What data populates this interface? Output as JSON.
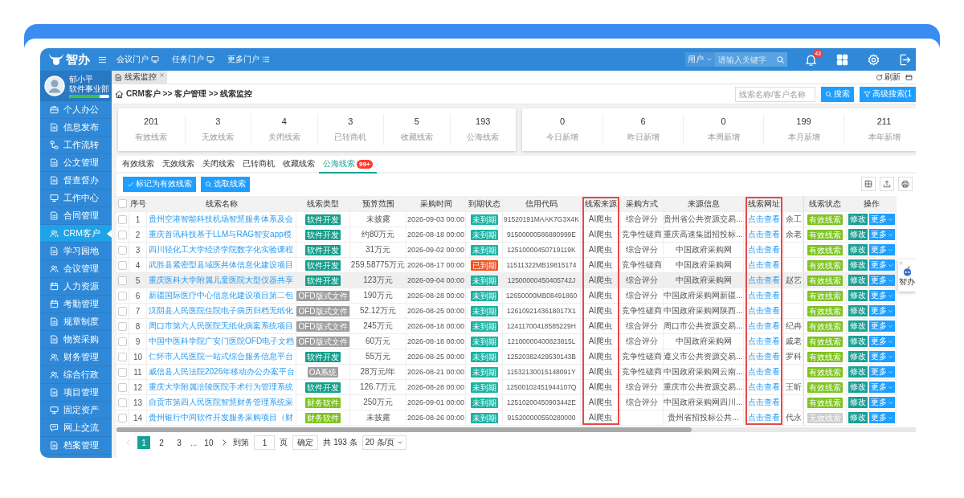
{
  "header": {
    "logo": "智办",
    "nav": [
      {
        "label": "会议门户",
        "kind": "screen"
      },
      {
        "label": "任务门户",
        "kind": "screen"
      },
      {
        "label": "更多门户",
        "kind": "list"
      }
    ],
    "search": {
      "scope": "用户",
      "placeholder": "请输入关键字"
    },
    "notifications": "43"
  },
  "user": {
    "name": "郁小平",
    "department": "软件事业部",
    "level": 0.75
  },
  "sidebar": {
    "items": [
      {
        "label": "个人办公",
        "selected": false
      },
      {
        "label": "信息发布",
        "selected": false
      },
      {
        "label": "工作流转",
        "selected": false
      },
      {
        "label": "公文管理",
        "selected": false
      },
      {
        "label": "督查督办",
        "selected": false
      },
      {
        "label": "工作中心",
        "selected": false
      },
      {
        "label": "合同管理",
        "selected": false
      },
      {
        "label": "CRM客户",
        "selected": true
      },
      {
        "label": "学习园地",
        "selected": false
      },
      {
        "label": "会议管理",
        "selected": false
      },
      {
        "label": "人力资源",
        "selected": false
      },
      {
        "label": "考勤管理",
        "selected": false
      },
      {
        "label": "规章制度",
        "selected": false
      },
      {
        "label": "物资采购",
        "selected": false
      },
      {
        "label": "财务管理",
        "selected": false
      },
      {
        "label": "综合行政",
        "selected": false
      },
      {
        "label": "项目管理",
        "selected": false
      },
      {
        "label": "固定资产",
        "selected": false
      },
      {
        "label": "网上交流",
        "selected": false
      },
      {
        "label": "档案管理",
        "selected": false
      }
    ]
  },
  "page_tabs": [
    {
      "label": "线索监控",
      "selected": true
    }
  ],
  "refresh": "刷新",
  "breadcrumb": "CRM客户 >> 客户管理 >> 线索监控",
  "lead_search": {
    "placeholder": "线索名称/客户名称",
    "search_button": "搜索",
    "advanced_button": "高级搜索(1"
  },
  "lead_totals": [
    {
      "value": "201",
      "label": "有效线索"
    },
    {
      "value": "3",
      "label": "无效线索"
    },
    {
      "value": "4",
      "label": "关闭线索"
    },
    {
      "value": "3",
      "label": "已转商机"
    },
    {
      "value": "5",
      "label": "收藏线索"
    },
    {
      "value": "193",
      "label": "公海线索"
    }
  ],
  "new_counts": [
    {
      "value": "0",
      "label": "今日新增"
    },
    {
      "value": "6",
      "label": "昨日新增"
    },
    {
      "value": "0",
      "label": "本周新增"
    },
    {
      "value": "199",
      "label": "本月新增"
    },
    {
      "value": "211",
      "label": "本年新增"
    }
  ],
  "subtabs": [
    {
      "label": "有效线索",
      "selected": false
    },
    {
      "label": "无效线索",
      "selected": false
    },
    {
      "label": "关闭线索",
      "selected": false
    },
    {
      "label": "已转商机",
      "selected": false
    },
    {
      "label": "收藏线索",
      "selected": false
    },
    {
      "label": "公海线索",
      "selected": true,
      "badge": "99+"
    }
  ],
  "actions": [
    "标记为有效线索",
    "选取线索"
  ],
  "table": {
    "select_all": {
      "checked": false
    },
    "columns": [
      {
        "label": "序号",
        "highlighted": false
      },
      {
        "label": "线索名称",
        "highlighted": false
      },
      {
        "label": "线索类型",
        "highlighted": false
      },
      {
        "label": "预算范围",
        "highlighted": false
      },
      {
        "label": "采购时间",
        "highlighted": false
      },
      {
        "label": "到期状态",
        "highlighted": false
      },
      {
        "label": "信用代码",
        "highlighted": false
      },
      {
        "label": "线索来源",
        "highlighted": true
      },
      {
        "label": "采购方式",
        "highlighted": false
      },
      {
        "label": "来源信息",
        "highlighted": false
      },
      {
        "label": "线索网址",
        "highlighted": true
      },
      {
        "label": "线索状态",
        "highlighted": false
      },
      {
        "label": "操作",
        "highlighted": false
      }
    ],
    "rows": [
      {
        "checked": false,
        "hovered": false,
        "index": "1",
        "name": "贵州空港智能科技机场智慧服务体系及会",
        "type": {
          "label": "软件开发",
          "color": "#139f8b"
        },
        "budget": "未披露",
        "time": "2026-09-03 00:00",
        "expiry": {
          "label": "未到期",
          "color": "#17b3a3"
        },
        "code": "91520191MAAK7G3X4K",
        "source": "AI爬虫",
        "method": "综合评分",
        "info": "贵州省公共资源交易...",
        "url": "点击查看",
        "contact": "余工",
        "status": {
          "label": "有效线索",
          "color": "#7dc31f"
        },
        "actions": [
          "修改",
          "更多"
        ]
      },
      {
        "checked": false,
        "hovered": false,
        "index": "2",
        "name": "重庆首讯科技基于LLM与RAG智安app模",
        "type": {
          "label": "软件开发",
          "color": "#139f8b"
        },
        "budget": "约80万元",
        "time": "2026-08-18 00:00",
        "expiry": {
          "label": "未到期",
          "color": "#17b3a3"
        },
        "code": "91500000586880999E",
        "source": "AI爬虫",
        "method": "竞争性磋商",
        "info": "重庆高速集团招投标...",
        "url": "点击查看",
        "contact": "余老",
        "status": {
          "label": "有效线索",
          "color": "#7dc31f"
        },
        "actions": [
          "修改",
          "更多"
        ]
      },
      {
        "checked": false,
        "hovered": false,
        "index": "3",
        "name": "四川轻化工大学经济学院数字化实验课程",
        "type": {
          "label": "软件开发",
          "color": "#139f8b"
        },
        "budget": "31万元",
        "time": "2026-09-02 00:00",
        "expiry": {
          "label": "未到期",
          "color": "#17b3a3"
        },
        "code": "12510000450719119K",
        "source": "AI爬虫",
        "method": "综合评分",
        "info": "中国政府采购网",
        "url": "点击查看",
        "status": {
          "label": "有效线索",
          "color": "#7dc31f"
        },
        "actions": [
          "修改",
          "更多"
        ]
      },
      {
        "checked": false,
        "hovered": false,
        "index": "4",
        "name": "武胜县紧密型县域医共体信息化建设项目",
        "type": {
          "label": "软件开发",
          "color": "#139f8b"
        },
        "budget": "259.58775万元",
        "time": "2026-08-17 00:00",
        "expiry": {
          "label": "已到期",
          "color": "#f4511e"
        },
        "code": "11511322MB19815174",
        "source": "AI爬虫",
        "method": "竞争性磋商",
        "info": "中国政府采购网",
        "url": "点击查看",
        "status": {
          "label": "有效线索",
          "color": "#7dc31f"
        },
        "actions": [
          "修改",
          "更多"
        ]
      },
      {
        "checked": false,
        "hovered": true,
        "index": "5",
        "name": "重庆医科大学附属儿童医院大型仪器共享",
        "type": {
          "label": "软件开发",
          "color": "#139f8b"
        },
        "budget": "123万元",
        "time": "2026-09-04 00:00",
        "expiry": {
          "label": "未到期",
          "color": "#17b3a3"
        },
        "code": "12500000450405742J",
        "source": "AI爬虫",
        "method": "综合评分",
        "info": "中国政府采购网",
        "url": "点击查看",
        "contact": "赵艺",
        "status": {
          "label": "有效线索",
          "color": "#7dc31f"
        },
        "actions": [
          "修改",
          "更多"
        ]
      },
      {
        "checked": false,
        "hovered": false,
        "index": "6",
        "name": "新疆国际医疗中心信息化建设项目第二包",
        "type": {
          "label": "OFD版式文件",
          "color": "#9e9e9e"
        },
        "budget": "190万元",
        "time": "2026-08-28 00:00",
        "expiry": {
          "label": "未到期",
          "color": "#17b3a3"
        },
        "code": "12650000MB08491860",
        "source": "AI爬虫",
        "method": "综合评分",
        "info": "中国政府采购网新疆...",
        "url": "点击查看",
        "status": {
          "label": "有效线索",
          "color": "#7dc31f"
        },
        "actions": [
          "修改",
          "更多"
        ]
      },
      {
        "checked": false,
        "hovered": false,
        "index": "7",
        "name": "汉阴县人民医院住院电子病历归档无纸化",
        "type": {
          "label": "OFD版式文件",
          "color": "#9e9e9e"
        },
        "budget": "52.12万元",
        "time": "2026-08-25 00:00",
        "expiry": {
          "label": "未到期",
          "color": "#17b3a3"
        },
        "code": "1261092143618017X1",
        "source": "AI爬虫",
        "method": "竞争性磋商",
        "info": "中国政府采购网陕西...",
        "url": "点击查看",
        "status": {
          "label": "有效线索",
          "color": "#7dc31f"
        },
        "actions": [
          "修改",
          "更多"
        ]
      },
      {
        "checked": false,
        "hovered": false,
        "index": "8",
        "name": "周口市第六人民医院无纸化病案系统项目",
        "type": {
          "label": "OFD版式文件",
          "color": "#9e9e9e"
        },
        "budget": "245万元",
        "time": "2026-08-18 00:00",
        "expiry": {
          "label": "未到期",
          "color": "#17b3a3"
        },
        "code": "12411700418585229H",
        "source": "AI爬虫",
        "method": "综合评分",
        "info": "周口市公共资源交易...",
        "url": "点击查看",
        "contact": "纪冉",
        "status": {
          "label": "有效线索",
          "color": "#7dc31f"
        },
        "actions": [
          "修改",
          "更多"
        ]
      },
      {
        "checked": false,
        "hovered": false,
        "index": "9",
        "name": "中国中医科学院广安门医院OFD电子文档",
        "type": {
          "label": "OFD版式文件",
          "color": "#9e9e9e"
        },
        "budget": "60万元",
        "time": "2026-08-18 00:00",
        "expiry": {
          "label": "未到期",
          "color": "#17b3a3"
        },
        "code": "12100000400823815L",
        "source": "AI爬虫",
        "method": "综合评分",
        "info": "中国政府采购网",
        "url": "点击查看",
        "contact": "戚老",
        "status": {
          "label": "有效线索",
          "color": "#7dc31f"
        },
        "actions": [
          "修改",
          "更多"
        ]
      },
      {
        "checked": false,
        "hovered": false,
        "index": "10",
        "name": "仁怀市人民医院一站式综合服务信息平台",
        "type": {
          "label": "软件开发",
          "color": "#139f8b"
        },
        "budget": "55万元",
        "time": "2026-08-25 00:00",
        "expiry": {
          "label": "未到期",
          "color": "#17b3a3"
        },
        "code": "12520382429530143B",
        "source": "AI爬虫",
        "method": "竞争性磋商",
        "info": "遵义市公共资源交易...",
        "url": "点击查看",
        "contact": "罗科",
        "status": {
          "label": "有效线索",
          "color": "#7dc31f"
        },
        "actions": [
          "修改",
          "更多"
        ]
      },
      {
        "checked": false,
        "hovered": false,
        "index": "11",
        "name": "威信县人民法院2026年移动办公办案平台",
        "type": {
          "label": "OA系统",
          "color": "#9e9e9e"
        },
        "budget": "28万元/年",
        "time": "2026-08-21 00:00",
        "expiry": {
          "label": "未到期",
          "color": "#17b3a3"
        },
        "code": "11532130015148091Y",
        "source": "AI爬虫",
        "method": "竞争性磋商",
        "info": "中国政府采购网云南...",
        "url": "点击查看",
        "status": {
          "label": "有效线索",
          "color": "#7dc31f"
        },
        "actions": [
          "修改",
          "更多"
        ]
      },
      {
        "checked": false,
        "hovered": false,
        "index": "12",
        "name": "重庆大学附属涪陵医院手术行为管理系统",
        "type": {
          "label": "软件开发",
          "color": "#139f8b"
        },
        "budget": "126.7万元",
        "time": "2026-08-28 00:00",
        "expiry": {
          "label": "未到期",
          "color": "#17b3a3"
        },
        "code": "12500102451944107Q",
        "source": "AI爬虫",
        "method": "综合评分",
        "info": "重庆市公共资源交易...",
        "url": "点击查看",
        "contact": "王昕",
        "status": {
          "label": "有效线索",
          "color": "#7dc31f"
        },
        "actions": [
          "修改",
          "更多"
        ]
      },
      {
        "checked": false,
        "hovered": false,
        "index": "13",
        "name": "自贡市第四人民医院智慧财务管理系统采",
        "type": {
          "label": "财务软件",
          "color": "#7dc31f"
        },
        "budget": "250万元",
        "time": "2026-09-01 00:00",
        "expiry": {
          "label": "未到期",
          "color": "#17b3a3"
        },
        "code": "12510200450903442E",
        "source": "AI爬虫",
        "method": "综合评分",
        "info": "中国政府采购网四川...",
        "url": "点击查看",
        "status": {
          "label": "有效线索",
          "color": "#7dc31f"
        },
        "actions": [
          "修改",
          "更多"
        ]
      },
      {
        "checked": false,
        "hovered": false,
        "index": "14",
        "name": "贵州银行中间软件开发服务采购项目（财",
        "type": {
          "label": "财务软件",
          "color": "#7dc31f"
        },
        "budget": "未披露",
        "time": "2026-08-26 00:00",
        "expiry": {
          "label": "未到期",
          "color": "#17b3a3"
        },
        "code": "915200000550280000",
        "source": "AI爬虫",
        "info": "贵州省招投标公共...",
        "url": "点击查看",
        "contact": "代永",
        "status": {
          "label": "无效线索",
          "color": "#cccccc"
        },
        "actions": [
          "修改",
          "更多"
        ]
      }
    ]
  },
  "assistant": {
    "label": "智办"
  },
  "pagination": {
    "prev": {
      "disabled": true
    },
    "next": {
      "disabled": false
    },
    "pages": [
      {
        "kind": "page",
        "label": "1",
        "selected": true
      },
      {
        "kind": "page",
        "label": "2",
        "selected": false
      },
      {
        "kind": "page",
        "label": "3",
        "selected": false
      },
      {
        "kind": "gap",
        "label": "...",
        "selected": false
      },
      {
        "kind": "page",
        "label": "10",
        "selected": false
      }
    ],
    "goto_label": "到第",
    "goto_value": "1",
    "page_unit": "页",
    "confirm": "确定",
    "total": "共 193 条",
    "page_size": "20 条/页"
  }
}
